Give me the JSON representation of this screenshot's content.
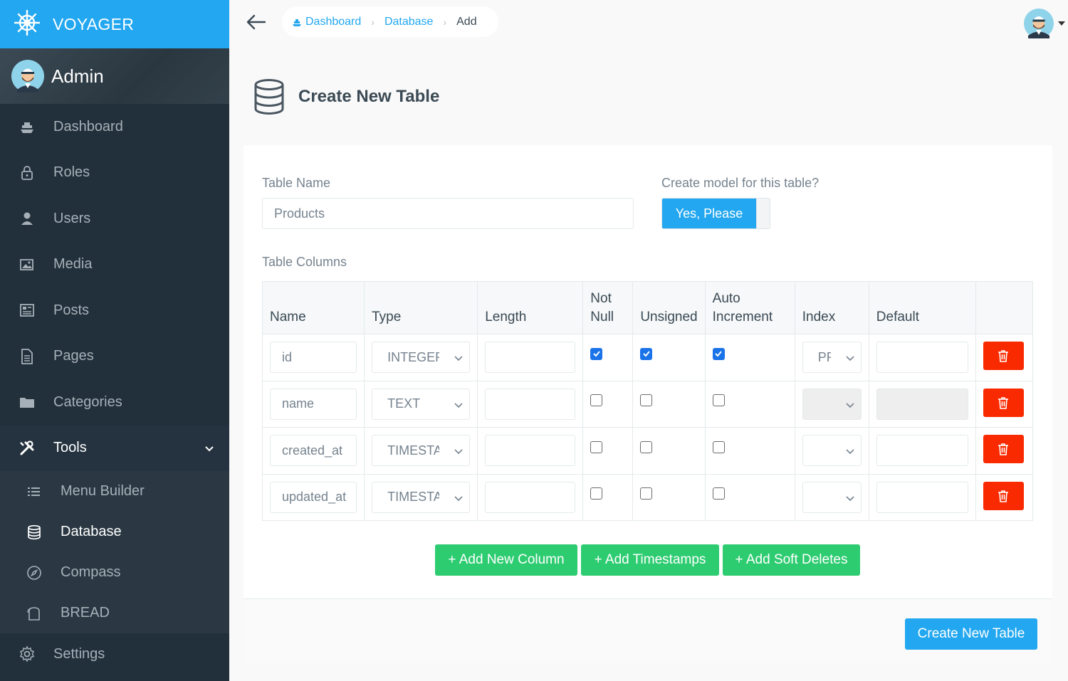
{
  "brand": {
    "name": "VOYAGER"
  },
  "profile": {
    "name": "Admin"
  },
  "sidebar": {
    "items": [
      {
        "label": "Dashboard",
        "icon": "boat-icon"
      },
      {
        "label": "Roles",
        "icon": "lock-icon"
      },
      {
        "label": "Users",
        "icon": "person-icon"
      },
      {
        "label": "Media",
        "icon": "images-icon"
      },
      {
        "label": "Posts",
        "icon": "news-icon"
      },
      {
        "label": "Pages",
        "icon": "file-text-icon"
      },
      {
        "label": "Categories",
        "icon": "folder-icon"
      },
      {
        "label": "Tools",
        "icon": "tools-icon",
        "expanded": true
      }
    ],
    "tools_sub": [
      {
        "label": "Menu Builder",
        "icon": "list-icon"
      },
      {
        "label": "Database",
        "icon": "database-icon",
        "active": true
      },
      {
        "label": "Compass",
        "icon": "compass-icon"
      },
      {
        "label": "BREAD",
        "icon": "bread-icon"
      }
    ],
    "settings": {
      "label": "Settings",
      "icon": "gear-icon"
    }
  },
  "breadcrumb": {
    "items": [
      "Dashboard",
      "Database"
    ],
    "current": "Add"
  },
  "page": {
    "title": "Create New Table"
  },
  "form": {
    "table_name_label": "Table Name",
    "table_name_value": "Products",
    "model_label": "Create model for this table?",
    "model_toggle_label": "Yes, Please",
    "columns_label": "Table Columns"
  },
  "table": {
    "headers": {
      "name": "Name",
      "type": "Type",
      "length": "Length",
      "not_null_1": "Not",
      "not_null_2": "Null",
      "unsigned": "Unsigned",
      "auto_1": "Auto",
      "auto_2": "Increment",
      "index": "Index",
      "default": "Default"
    },
    "rows": [
      {
        "name": "id",
        "type": "INTEGER",
        "length": "",
        "not_null": true,
        "unsigned": true,
        "auto_increment": true,
        "index": "PR",
        "default": "",
        "index_disabled": false,
        "default_disabled": false
      },
      {
        "name": "name",
        "type": "TEXT",
        "length": "",
        "not_null": false,
        "unsigned": false,
        "auto_increment": false,
        "index": "",
        "default": "",
        "index_disabled": true,
        "default_disabled": true
      },
      {
        "name": "created_at",
        "type": "TIMESTAMP",
        "length": "",
        "not_null": false,
        "unsigned": false,
        "auto_increment": false,
        "index": "",
        "default": "",
        "index_disabled": false,
        "default_disabled": false
      },
      {
        "name": "updated_at",
        "type": "TIMESTAMP",
        "length": "",
        "not_null": false,
        "unsigned": false,
        "auto_increment": false,
        "index": "",
        "default": "",
        "index_disabled": false,
        "default_disabled": false
      }
    ]
  },
  "buttons": {
    "add_column": "+ Add New Column",
    "add_timestamps": "+ Add Timestamps",
    "add_soft_deletes": "+ Add Soft Deletes",
    "create_table": "Create New Table"
  },
  "colors": {
    "primary": "#22a7f0",
    "success": "#2ecc71",
    "danger": "#fa2a00",
    "sidebar": "#22303b"
  }
}
